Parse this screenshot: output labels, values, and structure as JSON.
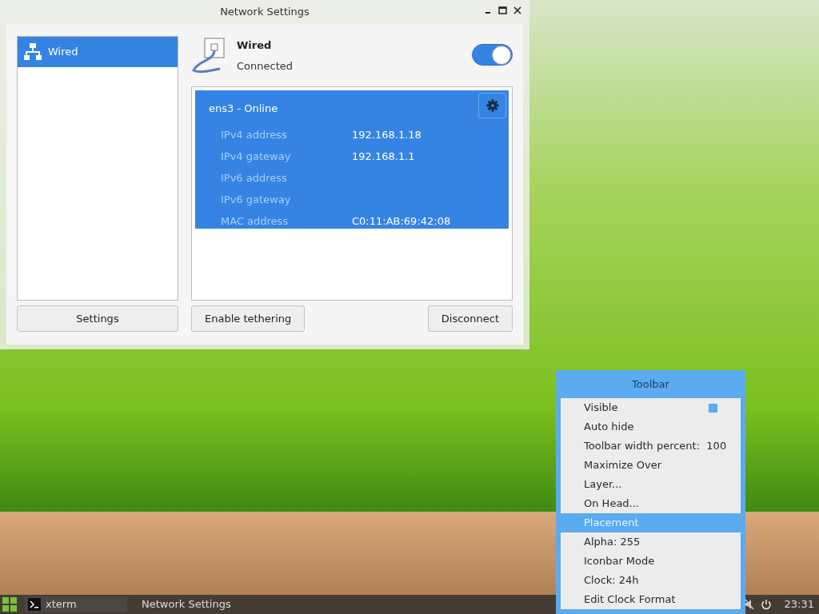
{
  "window": {
    "title": "Network Settings"
  },
  "sidebar": {
    "items": [
      {
        "label": "Wired",
        "selected": true
      }
    ]
  },
  "device": {
    "name": "Wired",
    "status": "Connected",
    "on": true
  },
  "connection": {
    "title": "ens3 - Online",
    "details": [
      {
        "label": "IPv4 address",
        "value": "192.168.1.18"
      },
      {
        "label": "IPv4 gateway",
        "value": "192.168.1.1"
      },
      {
        "label": "IPv6 address"
      },
      {
        "label": "IPv6 gateway"
      },
      {
        "label": "MAC address",
        "value": "C0:11:AB:69:42:08"
      }
    ]
  },
  "buttons": {
    "settings": "Settings",
    "tethering": "Enable tethering",
    "disconnect": "Disconnect"
  },
  "menu": {
    "title": "Toolbar",
    "items": [
      {
        "label": "Visible",
        "kind": "toggle",
        "checked": true,
        "selected": false
      },
      {
        "label": "Auto hide",
        "kind": "plain",
        "selected": false
      },
      {
        "label": "Toolbar width percent:  100",
        "kind": "plain",
        "selected": false
      },
      {
        "label": "Maximize Over",
        "kind": "plain",
        "selected": false
      },
      {
        "label": "Layer...",
        "kind": "plain",
        "selected": false
      },
      {
        "label": "On Head...",
        "kind": "plain",
        "selected": false
      },
      {
        "label": "Placement",
        "kind": "plain",
        "selected": true
      },
      {
        "label": "Alpha: 255",
        "kind": "plain",
        "selected": false
      },
      {
        "label": "Iconbar Mode",
        "kind": "plain",
        "selected": false
      },
      {
        "label": "Clock: 24h",
        "kind": "plain",
        "selected": false
      },
      {
        "label": "Edit Clock Format",
        "kind": "plain",
        "selected": false
      }
    ]
  },
  "taskbar": {
    "tasks": [
      {
        "label": "xterm",
        "kind": "terminal",
        "selected": true
      },
      {
        "label": "Network Settings",
        "kind": "window",
        "selected": false
      }
    ],
    "clock": "23:31"
  }
}
